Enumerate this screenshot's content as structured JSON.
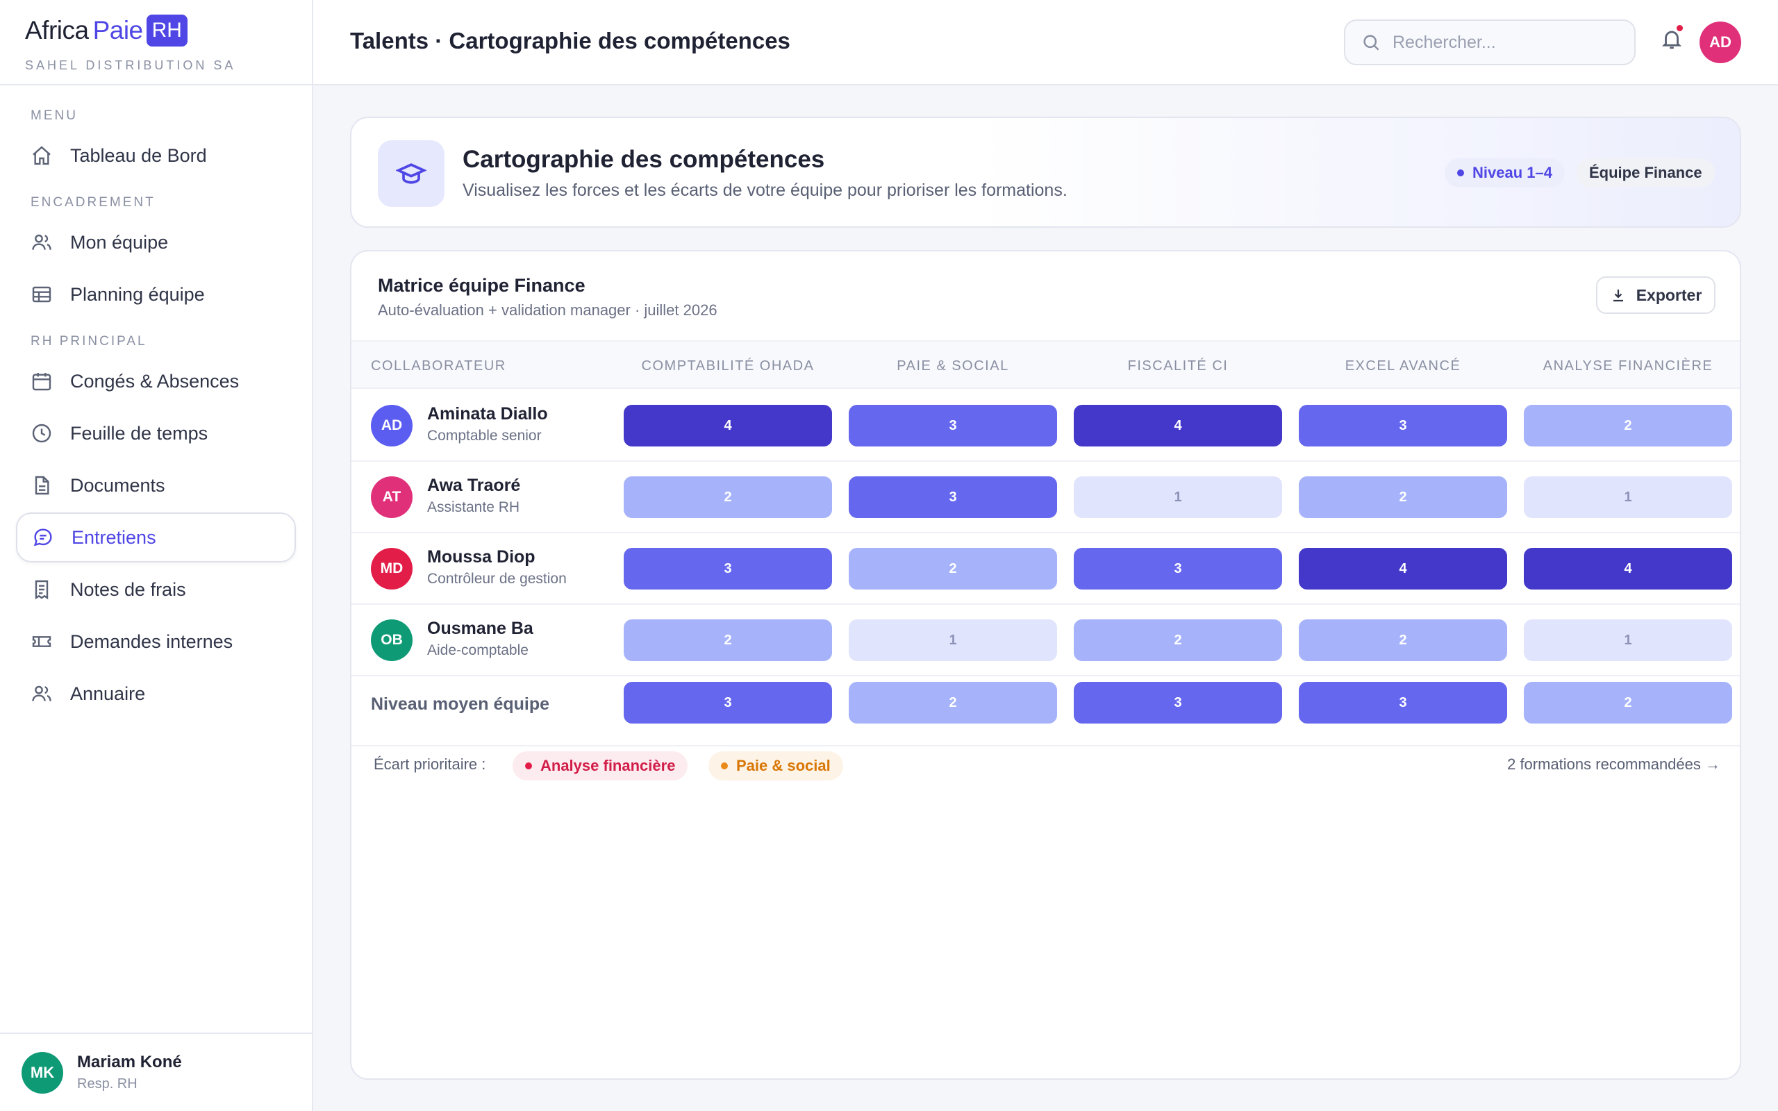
{
  "brand": {
    "africa": "Africa",
    "paie": "Paie",
    "rh": "RH",
    "company": "SAHEL DISTRIBUTION SA"
  },
  "sidebar": {
    "sections": [
      "MENU",
      "ENCADREMENT",
      "RH PRINCIPAL"
    ],
    "items": [
      {
        "label": "Tableau de Bord",
        "icon": "home-icon"
      },
      {
        "label": "Mon équipe",
        "icon": "users-icon"
      },
      {
        "label": "Planning équipe",
        "icon": "table-icon"
      },
      {
        "label": "Congés & Absences",
        "icon": "calendar-icon"
      },
      {
        "label": "Feuille de temps",
        "icon": "clock-icon"
      },
      {
        "label": "Documents",
        "icon": "document-icon"
      },
      {
        "label": "Entretiens",
        "icon": "chat-icon",
        "active": true
      },
      {
        "label": "Notes de frais",
        "icon": "receipt-icon"
      },
      {
        "label": "Demandes internes",
        "icon": "ticket-icon"
      },
      {
        "label": "Annuaire",
        "icon": "directory-icon"
      }
    ],
    "user": {
      "initials": "MK",
      "name": "Mariam Koné",
      "role": "Resp. RH"
    }
  },
  "header": {
    "title": "Talents · Cartographie des compétences",
    "search_placeholder": "Rechercher...",
    "avatar_initials": "AD"
  },
  "hero": {
    "title": "Cartographie des compétences",
    "subtitle": "Visualisez les forces et les écarts de votre équipe pour prioriser les formations.",
    "chip_level": "Niveau 1–4",
    "chip_team": "Équipe Finance"
  },
  "matrix": {
    "title": "Matrice équipe Finance",
    "subtitle": "Auto-évaluation + validation manager · juillet 2026",
    "export_label": "Exporter",
    "columns": [
      "COLLABORATEUR",
      "COMPTABILITÉ OHADA",
      "PAIE & SOCIAL",
      "FISCALITÉ CI",
      "EXCEL AVANCÉ",
      "ANALYSE FINANCIÈRE"
    ],
    "rows": [
      {
        "initials": "AD",
        "name": "Aminata Diallo",
        "role": "Comptable senior",
        "color": "#5b5cf0",
        "levels": [
          4,
          3,
          4,
          3,
          2
        ]
      },
      {
        "initials": "AT",
        "name": "Awa Traoré",
        "role": "Assistante RH",
        "color": "#e0307a",
        "levels": [
          2,
          3,
          1,
          2,
          1
        ]
      },
      {
        "initials": "MD",
        "name": "Moussa Diop",
        "role": "Contrôleur de gestion",
        "color": "#e11d48",
        "levels": [
          3,
          2,
          3,
          4,
          4
        ]
      },
      {
        "initials": "OB",
        "name": "Ousmane Ba",
        "role": "Aide-comptable",
        "color": "#0f9a76",
        "levels": [
          2,
          1,
          2,
          2,
          1
        ]
      }
    ],
    "average": {
      "label": "Niveau moyen équipe",
      "levels": [
        3,
        2,
        3,
        3,
        2
      ]
    },
    "gap_label": "Écart prioritaire :",
    "gaps": [
      "Analyse financière",
      "Paie & social"
    ],
    "recommendations": "2 formations recommandées →"
  }
}
